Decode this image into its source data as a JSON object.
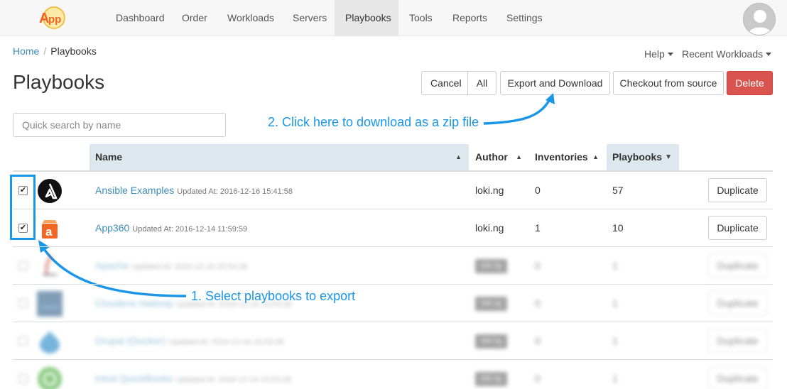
{
  "nav": {
    "logo_text": "App",
    "items": [
      {
        "label": "Dashboard",
        "active": false
      },
      {
        "label": "Order",
        "active": false
      },
      {
        "label": "Workloads",
        "active": false
      },
      {
        "label": "Servers",
        "active": false
      },
      {
        "label": "Playbooks",
        "active": true
      },
      {
        "label": "Tools",
        "active": false
      },
      {
        "label": "Reports",
        "active": false
      },
      {
        "label": "Settings",
        "active": false
      }
    ]
  },
  "breadcrumb": {
    "home": "Home",
    "current": "Playbooks"
  },
  "subnav": {
    "help": "Help",
    "recent": "Recent Workloads"
  },
  "page_title": "Playbooks",
  "toolbar": {
    "cancel": "Cancel",
    "all": "All",
    "export": "Export and Download",
    "checkout": "Checkout from source",
    "delete": "Delete"
  },
  "search": {
    "placeholder": "Quick search by name",
    "value": ""
  },
  "annotations": {
    "download": "2. Click here to download as a zip file",
    "select": "1. Select playbooks to export"
  },
  "table": {
    "columns": {
      "name": "Name",
      "author": "Author",
      "inventories": "Inventories",
      "playbooks": "Playbooks"
    },
    "updated_prefix": "Updated At:",
    "rows": [
      {
        "name": "Ansible Examples",
        "updated": "2016-12-16 15:41:58",
        "author": "loki.ng",
        "inventories": "0",
        "playbooks": "57",
        "checked": true,
        "icon": "ansible-icon",
        "action": "Duplicate"
      },
      {
        "name": "App360",
        "updated": "2016-12-14 11:59:59",
        "author": "loki.ng",
        "inventories": "1",
        "playbooks": "10",
        "checked": true,
        "icon": "app360-icon",
        "action": "Duplicate"
      },
      {
        "name": "Apache",
        "updated": "2016-12-16 15:53:28",
        "author": "loki.ng",
        "inventories": "0",
        "playbooks": "1",
        "checked": false,
        "icon": "apache-icon",
        "action": "Duplicate"
      },
      {
        "name": "Cloudera Hadoop",
        "updated": "2016-12-16 15:53:28",
        "author": "loki.ng",
        "inventories": "0",
        "playbooks": "1",
        "checked": false,
        "icon": "cloudera-icon",
        "action": "Duplicate"
      },
      {
        "name": "Drupal (Docker)",
        "updated": "2016-12-16 15:53:28",
        "author": "loki.ng",
        "inventories": "0",
        "playbooks": "1",
        "checked": false,
        "icon": "drupal-icon",
        "action": "Duplicate"
      },
      {
        "name": "Intuit QuickBooks",
        "updated": "2016-12-16 15:53:28",
        "author": "loki.ng",
        "inventories": "0",
        "playbooks": "1",
        "checked": false,
        "icon": "quickbooks-icon",
        "action": "Duplicate"
      }
    ]
  },
  "colors": {
    "accent": "#1a96e8",
    "link": "#3c8dbc",
    "danger": "#d9534f",
    "header_bg": "#dce7ee"
  }
}
